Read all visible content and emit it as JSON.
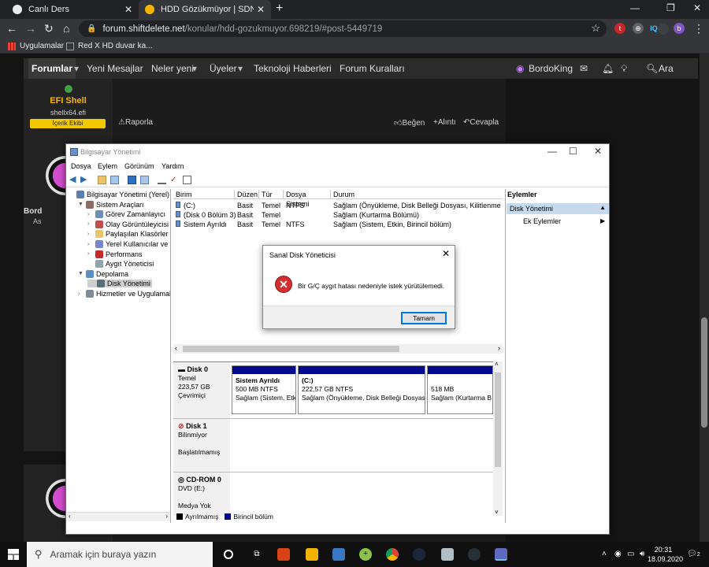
{
  "browser": {
    "tabs": [
      {
        "title": "Canlı Ders",
        "active": false
      },
      {
        "title": "HDD Gözükmüyor | SDN Forum",
        "active": true
      }
    ],
    "url_host": "forum.shiftdelete.net",
    "url_path": "/konular/hdd-gozukmuyor.698219/#post-5449719",
    "profile_initial": "b",
    "ext_iq": "IQ",
    "bookmarks": [
      "Uygulamalar",
      "Red X HD duvar ka..."
    ]
  },
  "forum": {
    "nav": [
      "Forumlar",
      "Yeni Mesajlar",
      "Neler yeni",
      "Üyeler",
      "Teknoloji Haberleri",
      "Forum Kuralları"
    ],
    "user": "BordoKing",
    "search": "Ara",
    "post1": {
      "author": "EFI Shell",
      "handle": "shellx64.efi",
      "badge": "İçerik Ekibi",
      "report": "Raporla",
      "like": "Beğen",
      "quote": "Alıntı",
      "reply": "Cevapla"
    },
    "post2": {
      "author_partial": "Bord",
      "sub_partial": "As"
    }
  },
  "mmc": {
    "title": "Bilgisayar Yönetimi",
    "menu": [
      "Dosya",
      "Eylem",
      "Görünüm",
      "Yardım"
    ],
    "tree": [
      {
        "label": "Bilgisayar Yönetimi (Yerel)",
        "level": 0,
        "twisty": ""
      },
      {
        "label": "Sistem Araçları",
        "level": 1,
        "twisty": "▼"
      },
      {
        "label": "Görev Zamanlayıcı",
        "level": 2,
        "twisty": "›"
      },
      {
        "label": "Olay Görüntüleyicisi",
        "level": 2,
        "twisty": "›"
      },
      {
        "label": "Paylaşılan Klasörler",
        "level": 2,
        "twisty": "›"
      },
      {
        "label": "Yerel Kullanıcılar ve Gru",
        "level": 2,
        "twisty": "›"
      },
      {
        "label": "Performans",
        "level": 2,
        "twisty": "›"
      },
      {
        "label": "Aygıt Yöneticisi",
        "level": 2,
        "twisty": ""
      },
      {
        "label": "Depolama",
        "level": 1,
        "twisty": "▼"
      },
      {
        "label": "Disk Yönetimi",
        "level": 2,
        "twisty": "",
        "selected": true
      },
      {
        "label": "Hizmetler ve Uygulamalar",
        "level": 1,
        "twisty": "›"
      }
    ],
    "list_headers": [
      "Birim",
      "Düzen",
      "Tür",
      "Dosya Sistemi",
      "Durum"
    ],
    "volumes": [
      {
        "name": "(C:)",
        "layout": "Basit",
        "type": "Temel",
        "fs": "NTFS",
        "status": "Sağlam (Önyükleme, Disk Belleği Dosyası, Kilitlenme Bilgis"
      },
      {
        "name": "(Disk 0 Bölüm 3)",
        "layout": "Basit",
        "type": "Temel",
        "fs": "",
        "status": "Sağlam (Kurtarma Bölümü)"
      },
      {
        "name": "Sistem Ayrıldı",
        "layout": "Basit",
        "type": "Temel",
        "fs": "NTFS",
        "status": "Sağlam (Sistem, Etkin, Birincil bölüm)"
      }
    ],
    "disks": [
      {
        "name": "Disk 0",
        "kind": "Temel",
        "size": "223,57 GB",
        "state": "Çevrimiçi",
        "partitions": [
          {
            "title": "Sistem Ayrıldı",
            "size": "500 MB NTFS",
            "status": "Sağlam (Sistem, Etk"
          },
          {
            "title": "(C:)",
            "size": "222,57 GB NTFS",
            "status": "Sağlam (Önyükleme, Disk Belleği Dosyası,"
          },
          {
            "title": "",
            "size": "518 MB",
            "status": "Sağlam (Kurtarma B"
          }
        ]
      },
      {
        "name": "Disk 1",
        "kind": "Bilinmiyor",
        "size": "",
        "state": "Başlatılmamış"
      },
      {
        "name": "CD-ROM 0",
        "kind": "DVD (E:)",
        "size": "",
        "state": "Medya Yok"
      }
    ],
    "legend": [
      "Ayrılmamış",
      "Birincil bölüm"
    ],
    "actions_header": "Eylemler",
    "actions_selected": "Disk Yönetimi",
    "actions_more": "Ek Eylemler"
  },
  "dialog": {
    "title": "Sanal Disk Yöneticisi",
    "message": "Bir G/Ç aygıt hatası nedeniyle istek yürütülemedi.",
    "ok": "Tamam"
  },
  "taskbar": {
    "search_placeholder": "Aramak için buraya yazın",
    "time": "20:31",
    "date": "18.09.2020",
    "notif_count": "2"
  },
  "colors": {
    "accent": "#0078d7",
    "partition_bar": "#000a8a",
    "error": "#d32f2f",
    "badge": "#f2c900"
  }
}
